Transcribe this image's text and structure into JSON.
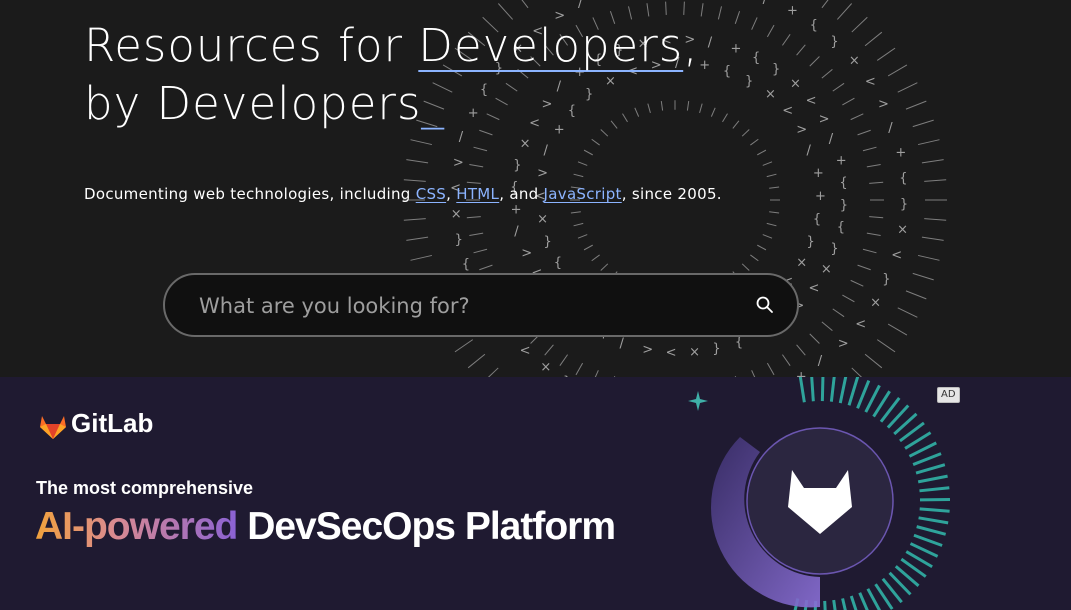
{
  "hero": {
    "title_line1_prefix": "Resources for ",
    "title_line1_link": "Developers",
    "title_line1_suffix": ",",
    "title_line2": "by Developers",
    "title_cursor": "_",
    "subtitle_prefix": "Documenting web technologies, including ",
    "link_css": "CSS",
    "sep1": ", ",
    "link_html": "HTML",
    "sep2": ", and ",
    "link_js": "JavaScript",
    "subtitle_suffix": ", since 2005.",
    "accent_color": "#8cb4ff",
    "background_color": "#1b1b1b"
  },
  "search": {
    "placeholder": "What are you looking for?",
    "value": "",
    "icon": "search-icon"
  },
  "ad": {
    "badge": "AD",
    "brand": "GitLab",
    "brand_icon": "gitlab-fox-icon",
    "tagline": "The most comprehensive",
    "headline_gradient": "AI-powered",
    "headline_rest": " DevSecOps Platform",
    "background_color": "#1f1a31"
  }
}
